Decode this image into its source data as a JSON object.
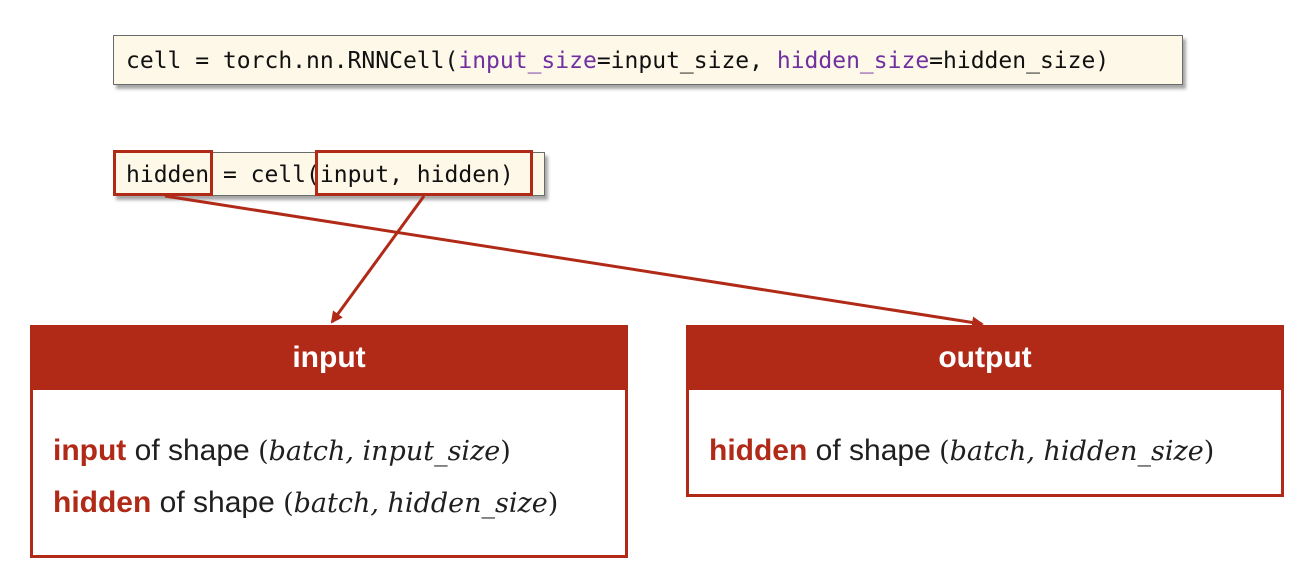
{
  "code_line_1": {
    "prefix": "cell = torch.nn.RNNCell(",
    "arg1_name": "input_size",
    "arg1_value": "=input_size, ",
    "arg2_name": "hidden_size",
    "arg2_value": "=hidden_size)"
  },
  "code_line_2": {
    "lhs": "hidden",
    "op": " = cell",
    "args": "(input, hidden)"
  },
  "input_box": {
    "title": "input",
    "rows": [
      {
        "term": "input",
        "text": " of shape ",
        "math_open": "(",
        "math": "batch, input_size",
        "math_close": ")"
      },
      {
        "term": "hidden",
        "text": " of shape ",
        "math_open": "(",
        "math": "batch, hidden_size",
        "math_close": ")"
      }
    ]
  },
  "output_box": {
    "title": "output",
    "rows": [
      {
        "term": "hidden",
        "text": " of shape ",
        "math_open": "(",
        "math": "batch, hidden_size",
        "math_close": ")"
      }
    ]
  },
  "colors": {
    "accent": "#b02a17",
    "code_background": "#fdf8e8",
    "keyword": "#7030a0"
  }
}
